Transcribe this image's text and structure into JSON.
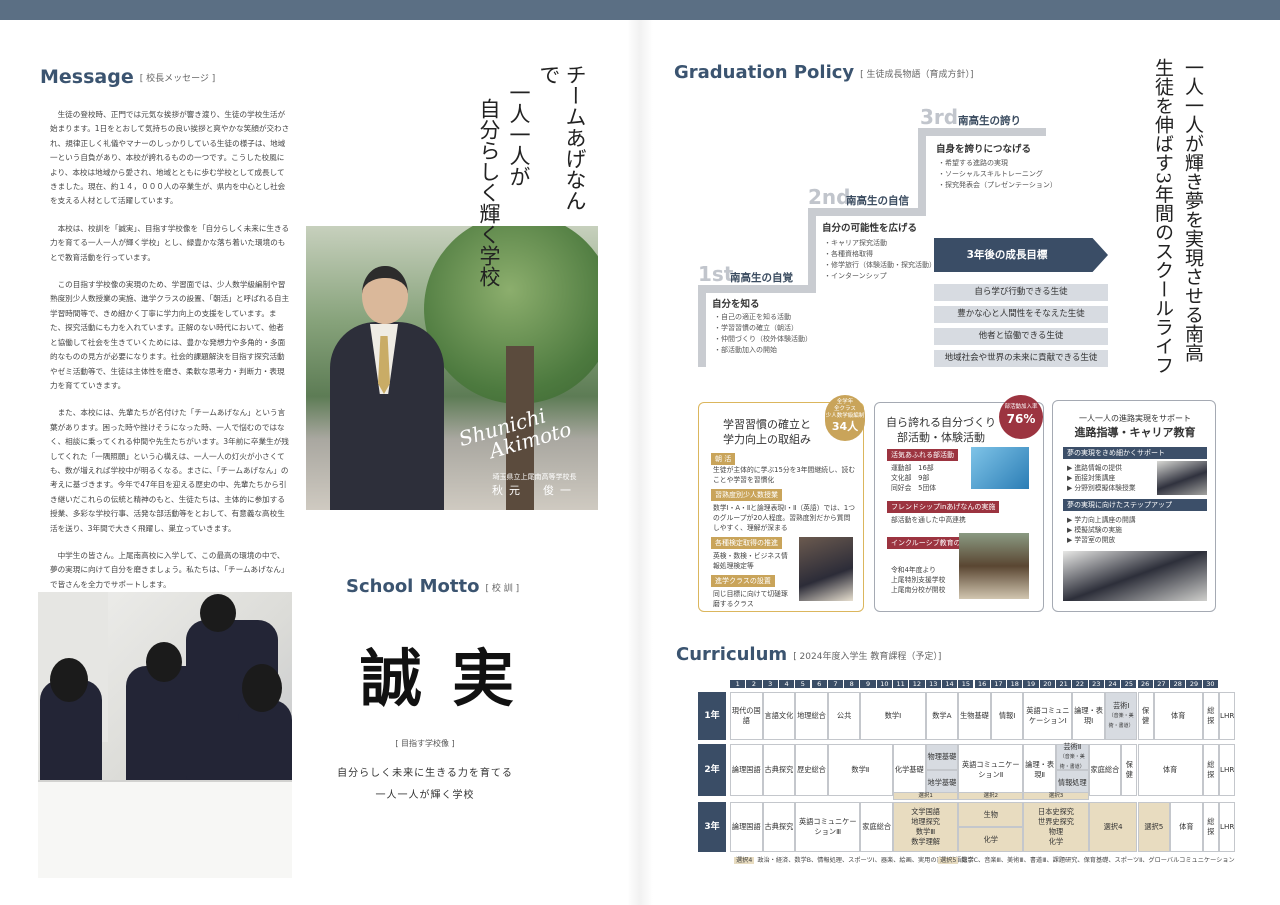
{
  "message": {
    "title": "Message",
    "sub": "[ 校長メッセージ ]",
    "p1": "生徒の登校時、正門では元気な挨拶が響き渡り、生徒の学校生活が始まります。1日をとおして気持ちの良い挨拶と爽やかな笑顔が交わされ、規律正しく礼儀やマナーのしっかりしている生徒の様子は、地域一という自負があり、本校が誇れるものの一つです。こうした校風により、本校は地域から愛され、地域とともに歩む学校として成長してきました。現在、約１４，０００人の卒業生が、県内を中心とし社会を支える人材として活躍しています。",
    "p2": "本校は、校訓を「誠実」、目指す学校像を「自分らしく未来に生きる力を育てる一人一人が輝く学校」とし、緑豊かな落ち着いた環境のもとで教育活動を行っています。",
    "p3": "この目指す学校像の実現のため、学習面では、少人数学級編制や習熟度別少人数授業の実施、進学クラスの設置、「朝活」と呼ばれる自主学習時間等で、きめ細かく丁寧に学力向上の支援をしています。また、探究活動にも力を入れています。正解のない時代において、他者と協働して社会を生きていくためには、豊かな発想力や多角的・多面的なものの見方が必要になります。社会的課題解決を目指す探究活動やゼミ活動等で、生徒は主体性を磨き、柔軟な思考力・判断力・表現力を育てていきます。",
    "p4": "また、本校には、先輩たちが名付けた「チームあげなん」という言葉があります。困った時や挫けそうになった時、一人で悩むのではなく、相談に乗ってくれる仲間や先生たちがいます。3年前に卒業生が残してくれた「一隅照願」という心構えは、一人一人の灯火が小さくても、数が増えれば学校中が明るくなる。まさに、「チームあげなん」の考えに基づきます。今年で47年目を迎える歴史の中、先輩たちから引き継いだこれらの伝統と精神のもと、生徒たちは、主体的に参加する授業、多彩な学校行事、活発な部活動等をとおして、有意義な高校生活を送り、3年間で大きく飛躍し、巣立っていきます。",
    "p5": "中学生の皆さん。上尾南高校に入学して、この最高の環境の中で、夢の実現に向けて自分を磨きましょう。私たちは、「チームあげなん」で皆さんを全力でサポートします。"
  },
  "slogan": {
    "l1": "チームあげなんで",
    "l2": "一人一人が",
    "l3": "自分らしく輝く学校"
  },
  "portrait": {
    "sign1": "Shunichi",
    "sign2": "Akimoto",
    "caption": "埼玉県立上尾南高等学校長",
    "name": "秋元　俊一"
  },
  "motto": {
    "title": "School Motto",
    "sub": "[ 校 訓 ]",
    "kanji": "誠実",
    "ideal": "[ 目指す学校像 ]",
    "line1": "自分らしく未来に生きる力を育てる",
    "line2": "一人一人が輝く学校"
  },
  "grad": {
    "title": "Graduation Policy",
    "sub": "[ 生徒成長物語（育成方針）]",
    "vert1": "一人一人が輝き夢を実現させる南高",
    "vert2": "生徒を伸ばす3年間のスクールライフ",
    "s1": {
      "num": "1st",
      "title": "南高生の自覚",
      "goal": "自分を知る",
      "items": [
        "・自己の適正を知る活動",
        "・学習習慣の確立（朝活）",
        "・仲間づくり（校外体験活動）",
        "・部活動加入の開始"
      ]
    },
    "s2": {
      "num": "2nd",
      "title": "南高生の自信",
      "goal": "自分の可能性を広げる",
      "items": [
        "・キャリア探究活動",
        "・各種資格取得",
        "・修学旅行（体験活動・探究活動）",
        "・インターンシップ"
      ]
    },
    "s3": {
      "num": "3rd",
      "title": "南高生の誇り",
      "goal": "自身を誇りにつなげる",
      "items": [
        "・希望する進路の実現",
        "・ソーシャルスキルトレーニング",
        "・探究発表会（プレゼンテーション）"
      ]
    },
    "arrow": "3年後の成長目標",
    "goals": [
      "自ら学び行動できる生徒",
      "豊かな心と人間性をそなえた生徒",
      "他者と協働できる生徒",
      "地域社会や世界の未来に貢献できる生徒"
    ]
  },
  "card1": {
    "title1": "学習習慣の確立と",
    "title2": "学力向上の取組み",
    "badge1": "全学年",
    "badge2": "全クラス",
    "badge3": "少人数学級編制",
    "badge4": "34人",
    "t1": "朝 活",
    "b1": "生徒が主体的に学ぶ15分を3年間継続し、読むことや学習を習慣化",
    "t2": "習熟度別少人数授業",
    "b2": "数学Ⅰ・A・Ⅱと論理表現Ⅰ・Ⅱ（英語）では、1つのグループが20人程度。習熟度別だから質問しやすく、理解が深まる",
    "t3": "各種検定取得の推進",
    "b3": "英検・数検・ビジネス情報処理検定等",
    "t4": "進学クラスの設置",
    "b4": "同じ目標に向けて切磋琢磨するクラス"
  },
  "card2": {
    "title1": "自ら誇れる自分づくり",
    "title2": "部活動・体験活動",
    "badge1": "部活動加入率",
    "badge2": "76%",
    "t1": "活気あふれる部活動",
    "b1": "運動部　16部",
    "b2": "文化部　9部",
    "b3": "同好会　5団体",
    "t2": "フレンドシップinあげなんの実施",
    "b4": "部活動を通した中高連携",
    "t3": "インクルーシブ教育の推進",
    "b5": "令和4年度より",
    "b6": "上尾特別支援学校",
    "b7": "上尾南分校が開校"
  },
  "card3": {
    "title1": "一人一人の進路実現をサポート",
    "title2": "進路指導・キャリア教育",
    "t1": "夢の実現をきめ細かくサポート",
    "items1": [
      "▶ 進路情報の提供",
      "▶ 面接対策講座",
      "▶ 分野別模擬体験授業"
    ],
    "t2": "夢の実現に向けたステップアップ",
    "items2": [
      "▶ 学力向上講座の開講",
      "▶ 模擬試験の実施",
      "▶ 学習室の開放"
    ]
  },
  "curriculum": {
    "title": "Curriculum",
    "sub": "[ 2024年度入学生 教育課程（予定）]",
    "cols": [
      "1",
      "2",
      "3",
      "4",
      "5",
      "6",
      "7",
      "8",
      "9",
      "10",
      "11",
      "12",
      "13",
      "14",
      "15",
      "16",
      "17",
      "18",
      "19",
      "20",
      "21",
      "22",
      "23",
      "24",
      "25",
      "26",
      "27",
      "28",
      "29",
      "30"
    ],
    "y1": {
      "label": "1年",
      "cells": [
        "現代の国語",
        "言語文化",
        "地理総合",
        "公共",
        "数学Ⅰ",
        "数学A",
        "生物基礎",
        "情報Ⅰ",
        "英語コミュニケーションⅠ",
        "論理・表現Ⅰ",
        "芸術Ⅰ",
        "（音楽・美術・書道）",
        "保健",
        "体育",
        "総探",
        "LHR"
      ]
    },
    "y2": {
      "label": "2年",
      "cells": [
        "論理国語",
        "古典探究",
        "歴史総合",
        "数学Ⅱ",
        "化学基礎",
        "物理基礎",
        "地学基礎",
        "英語コミュニケーションⅡ",
        "論理・表現Ⅱ",
        "芸術Ⅱ",
        "（音楽・美術・書道）",
        "情報処理",
        "家庭総合",
        "保健",
        "体育",
        "総探",
        "LHR"
      ]
    },
    "y3": {
      "label": "3年",
      "cells": [
        "論理国語",
        "古典探究",
        "英語コミュニケーションⅢ",
        "家庭総合",
        "選択1",
        "選択2",
        "選択3",
        "文学国語",
        "地理探究",
        "数学Ⅲ",
        "数学理解",
        "生物",
        "化学",
        "日本史探究",
        "世界史探究",
        "物理",
        "化学",
        "選択4",
        "選択5",
        "体育",
        "総探",
        "LHR"
      ]
    },
    "note4k": "選択4",
    "note4": "政治・経済、数学B、情報処理、スポーツⅠ、器楽、絵画、実用の書、英語総合",
    "note5k": "選択5",
    "note5": "数学C、音楽Ⅲ、美術Ⅲ、書道Ⅲ、課題研究、保育基礎、スポーツⅡ、グローバルコミュニケーション"
  }
}
